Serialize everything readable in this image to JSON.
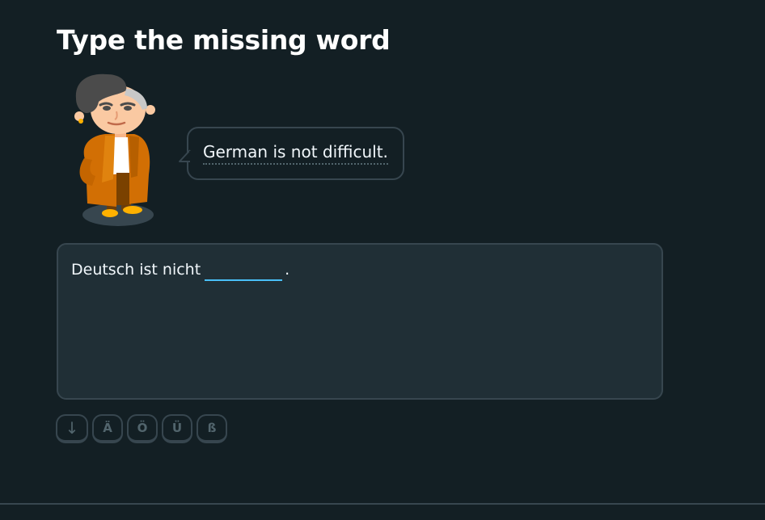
{
  "challenge": {
    "title": "Type the missing word"
  },
  "character": {
    "icon": "lily-character-icon"
  },
  "speech_bubble": {
    "text": "German is not difficult."
  },
  "sentence": {
    "prefix": "Deutsch ist nicht",
    "answer_value": "",
    "suffix": "."
  },
  "special_keys": {
    "collapse": "↓",
    "a_umlaut": "Ä",
    "o_umlaut": "Ö",
    "u_umlaut": "Ü",
    "eszett": "ß"
  },
  "colors": {
    "background": "#131f24",
    "panel": "#202f36",
    "border": "#37464f",
    "accent_blue": "#49c0f8",
    "key_text": "#52656d"
  }
}
